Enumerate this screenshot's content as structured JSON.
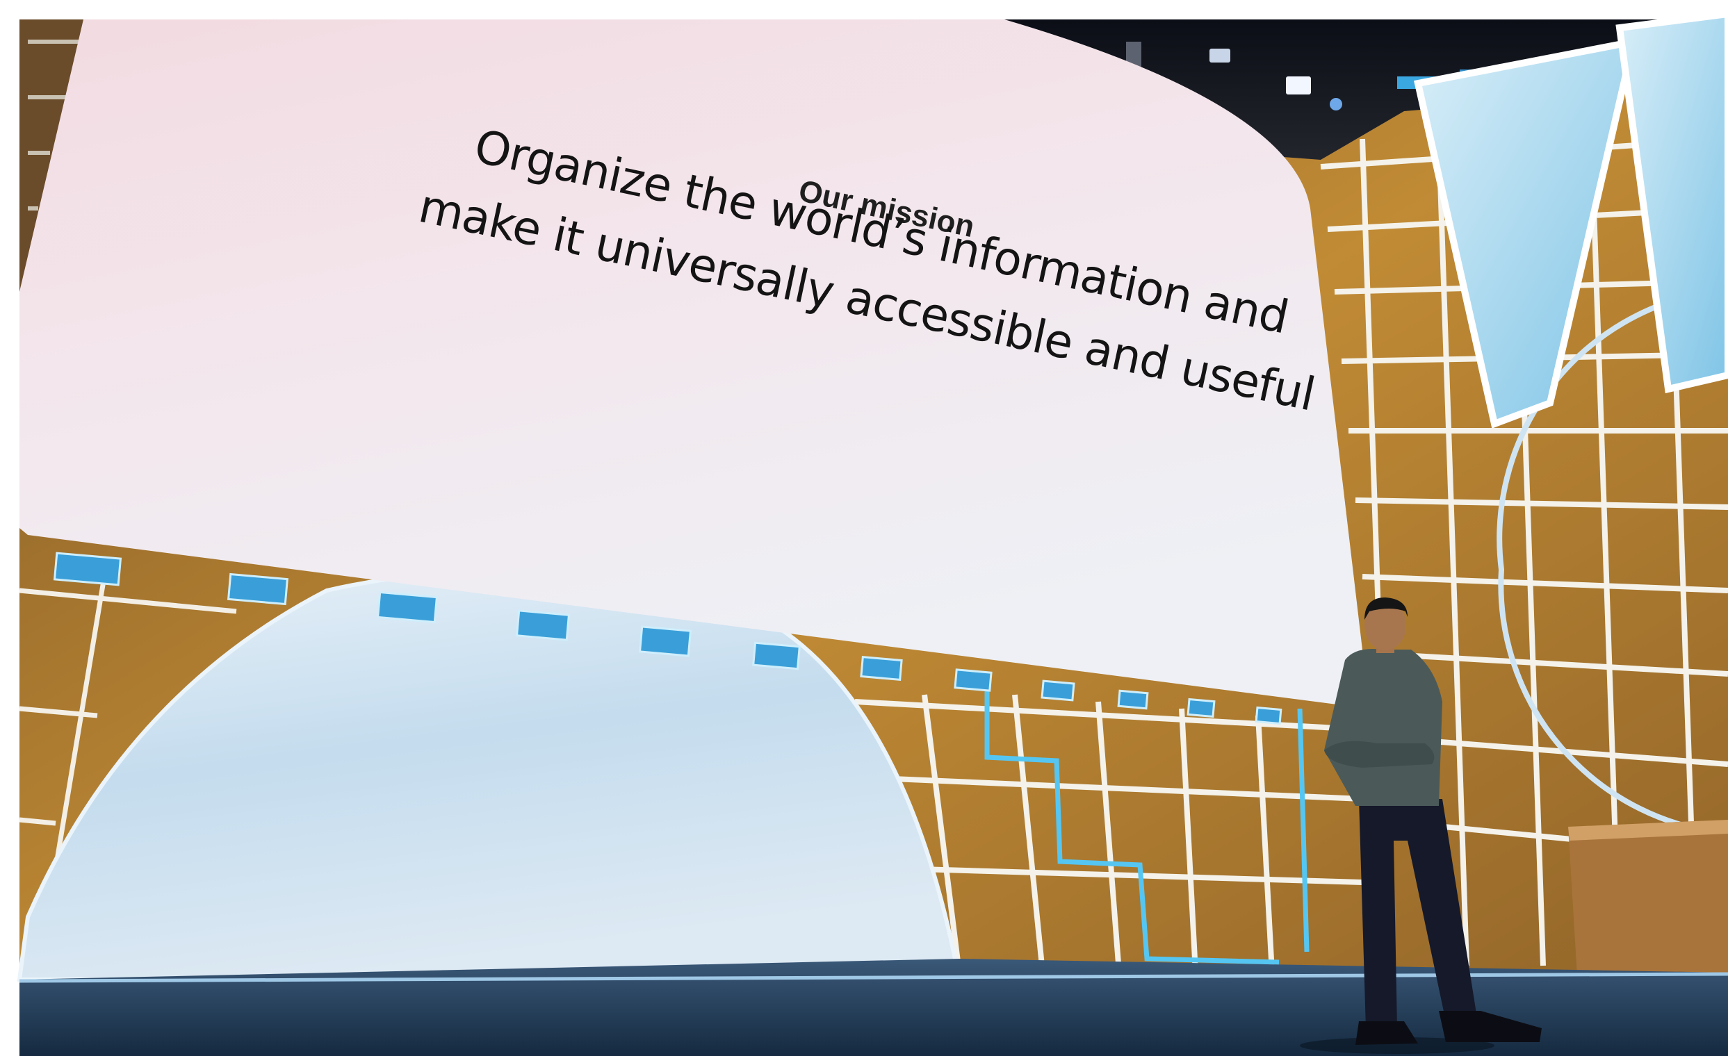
{
  "slide": {
    "heading": "Our mission",
    "line_1": "Organize the world’s information and",
    "line_2": "make it universally accessible and useful"
  },
  "colors": {
    "screen_pink": "#f3dde2",
    "screen_white": "#f4f4f6",
    "stage_wood": "#b8822f",
    "stage_floor": "#1f3650",
    "dome_blue": "#cfe3f2",
    "neon_blue": "#5cc8f0",
    "speaker_jacket": "#4a5a5a"
  },
  "icons": [
    "google-io-logo-icon"
  ]
}
